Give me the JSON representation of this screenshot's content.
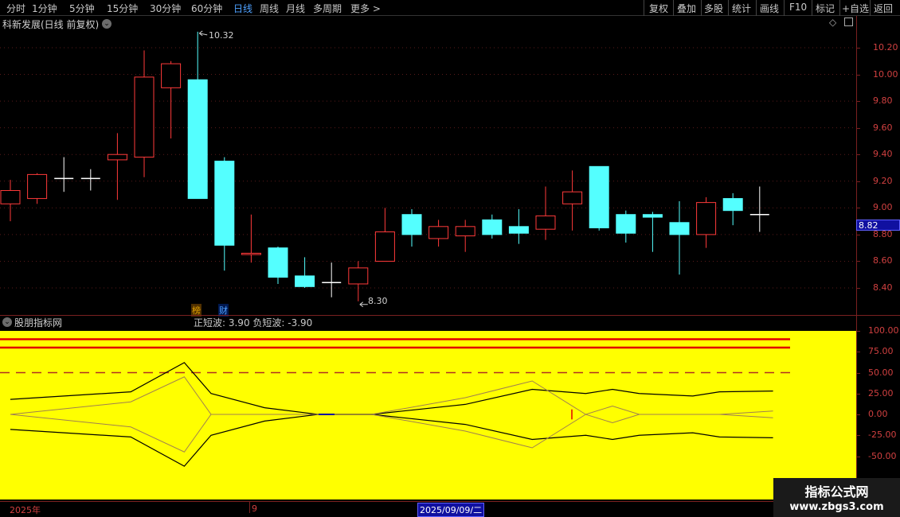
{
  "toolbar": {
    "timeframes": [
      "分时",
      "1分钟",
      "5分钟",
      "15分钟",
      "30分钟",
      "60分钟",
      "日线",
      "周线",
      "月线",
      "多周期",
      "更多 >"
    ],
    "active_timeframe": "日线",
    "controls": [
      "复权",
      "叠加",
      "多股",
      "统计",
      "画线",
      "F10",
      "标记",
      "+自选",
      "返回"
    ]
  },
  "main_chart": {
    "title": "科新发展(日线 前复权)",
    "high_label": "10.32",
    "low_label": "8.30",
    "current_price_tag": "8.82",
    "y_ticks": [
      "10.20",
      "10.00",
      "9.80",
      "9.60",
      "9.40",
      "9.20",
      "9.00",
      "8.80",
      "8.60",
      "8.40"
    ],
    "markers": [
      {
        "text": "榜",
        "color": "#e0a000"
      },
      {
        "text": "财",
        "color": "#4ea1ff"
      }
    ]
  },
  "indicator": {
    "title": "股朋指标网",
    "readout": "正短波: 3.90  负短波: -3.90",
    "y_ticks": [
      "100.00",
      "75.00",
      "50.00",
      "25.00",
      "0.00",
      "-25.00",
      "-50.00"
    ],
    "background": "#ffff00"
  },
  "bottom": {
    "year_label": "2025年",
    "month_label": "9",
    "date_label": "2025/09/09/二"
  },
  "watermark": {
    "title": "指标公式网",
    "url": "www.zbgs3.com"
  },
  "colors": {
    "up": "#ff3a3a",
    "down": "#54ffff",
    "axis": "#d04040",
    "grid": "#7a2020"
  },
  "chart_data": [
    {
      "type": "candlestick",
      "title": "科新发展(日线 前复权)",
      "ylim": [
        8.22,
        10.42
      ],
      "candles": [
        {
          "o": 9.03,
          "h": 9.21,
          "l": 8.9,
          "c": 9.13
        },
        {
          "o": 9.07,
          "h": 9.26,
          "l": 9.03,
          "c": 9.25
        },
        {
          "o": 9.22,
          "h": 9.38,
          "l": 9.12,
          "c": 9.22
        },
        {
          "o": 9.22,
          "h": 9.29,
          "l": 9.13,
          "c": 9.22
        },
        {
          "o": 9.36,
          "h": 9.56,
          "l": 9.06,
          "c": 9.4
        },
        {
          "o": 9.38,
          "h": 10.18,
          "l": 9.23,
          "c": 9.98
        },
        {
          "o": 9.9,
          "h": 10.1,
          "l": 9.52,
          "c": 10.08
        },
        {
          "o": 9.96,
          "h": 10.32,
          "l": 9.07,
          "c": 9.07
        },
        {
          "o": 9.35,
          "h": 9.38,
          "l": 8.53,
          "c": 8.72
        },
        {
          "o": 8.65,
          "h": 8.95,
          "l": 8.59,
          "c": 8.66
        },
        {
          "o": 8.7,
          "h": 8.71,
          "l": 8.43,
          "c": 8.48
        },
        {
          "o": 8.49,
          "h": 8.63,
          "l": 8.4,
          "c": 8.41
        },
        {
          "o": 8.44,
          "h": 8.59,
          "l": 8.33,
          "c": 8.44
        },
        {
          "o": 8.43,
          "h": 8.6,
          "l": 8.3,
          "c": 8.55
        },
        {
          "o": 8.6,
          "h": 9.0,
          "l": 8.6,
          "c": 8.82
        },
        {
          "o": 8.95,
          "h": 8.99,
          "l": 8.71,
          "c": 8.8
        },
        {
          "o": 8.77,
          "h": 8.91,
          "l": 8.71,
          "c": 8.86
        },
        {
          "o": 8.79,
          "h": 8.91,
          "l": 8.67,
          "c": 8.86
        },
        {
          "o": 8.91,
          "h": 8.95,
          "l": 8.77,
          "c": 8.8
        },
        {
          "o": 8.86,
          "h": 8.99,
          "l": 8.73,
          "c": 8.81
        },
        {
          "o": 8.84,
          "h": 9.16,
          "l": 8.76,
          "c": 8.94
        },
        {
          "o": 9.03,
          "h": 9.28,
          "l": 8.83,
          "c": 9.12
        },
        {
          "o": 9.31,
          "h": 9.31,
          "l": 8.83,
          "c": 8.85
        },
        {
          "o": 8.95,
          "h": 8.98,
          "l": 8.74,
          "c": 8.81
        },
        {
          "o": 8.95,
          "h": 8.97,
          "l": 8.67,
          "c": 8.93
        },
        {
          "o": 8.89,
          "h": 9.05,
          "l": 8.5,
          "c": 8.8
        },
        {
          "o": 8.8,
          "h": 9.08,
          "l": 8.7,
          "c": 9.04
        },
        {
          "o": 9.07,
          "h": 9.11,
          "l": 8.87,
          "c": 8.98
        },
        {
          "o": 8.95,
          "h": 9.16,
          "l": 8.82,
          "c": 8.95
        }
      ]
    },
    {
      "type": "line",
      "title": "股朋指标网",
      "ylim": [
        -100,
        100
      ],
      "x": [
        0,
        4.5,
        6.5,
        7.5,
        9.5,
        11.5,
        13.5,
        17,
        19.5,
        21.5,
        22.5,
        23.5,
        25.5,
        26.5,
        28.5
      ],
      "series": [
        {
          "name": "outer_top",
          "values": [
            18,
            27,
            62,
            25,
            8,
            0,
            0,
            12,
            30,
            25,
            30,
            25,
            22,
            27,
            28
          ]
        },
        {
          "name": "outer_bottom",
          "values": [
            -18,
            -27,
            -62,
            -25,
            -8,
            0,
            0,
            -12,
            -30,
            -25,
            -30,
            -25,
            -22,
            -27,
            -28
          ]
        },
        {
          "name": "inner_top",
          "values": [
            0,
            15,
            45,
            0,
            0,
            0,
            0,
            20,
            40,
            0,
            10,
            0,
            0,
            0,
            4
          ]
        },
        {
          "name": "inner_bottom",
          "values": [
            0,
            -15,
            -45,
            0,
            0,
            0,
            0,
            -20,
            -40,
            0,
            -10,
            0,
            0,
            0,
            -4
          ]
        }
      ],
      "reference_lines": [
        {
          "y": 90,
          "style": "solid"
        },
        {
          "y": 80,
          "style": "solid"
        },
        {
          "y": 50,
          "style": "dashed"
        }
      ]
    }
  ]
}
